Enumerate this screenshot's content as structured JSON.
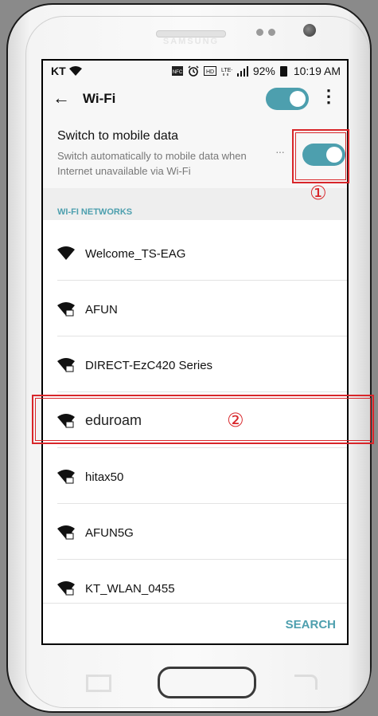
{
  "device": {
    "brand": "SAMSUNG"
  },
  "status_bar": {
    "carrier": "KT",
    "icons": [
      "wifi-signal-icon",
      "nfc-icon",
      "alarm-icon",
      "hd-voice-icon",
      "lte-plus-icon",
      "signal-bars-icon"
    ],
    "battery": "92%",
    "time": "10:19 AM"
  },
  "app_bar": {
    "title": "Wi-Fi",
    "wifi_enabled": true
  },
  "mobile_data": {
    "title": "Switch to mobile data",
    "description": "Switch automatically to mobile data when Internet unavailable via Wi-Fi",
    "enabled": true
  },
  "section": {
    "label": "WI-FI NETWORKS"
  },
  "networks": [
    {
      "name": "Welcome_TS-EAG",
      "secured": false
    },
    {
      "name": "AFUN",
      "secured": true
    },
    {
      "name": "DIRECT-EzC420 Series",
      "secured": true
    },
    {
      "name": "eduroam",
      "secured": true
    },
    {
      "name": "hitax50",
      "secured": true
    },
    {
      "name": "AFUN5G",
      "secured": true
    },
    {
      "name": "KT_WLAN_0455",
      "secured": true
    }
  ],
  "bottom": {
    "search_label": "SEARCH"
  },
  "annotations": {
    "marker_1": "①",
    "marker_2": "②"
  },
  "colors": {
    "accent": "#4d9fae",
    "highlight": "#d8262a"
  }
}
